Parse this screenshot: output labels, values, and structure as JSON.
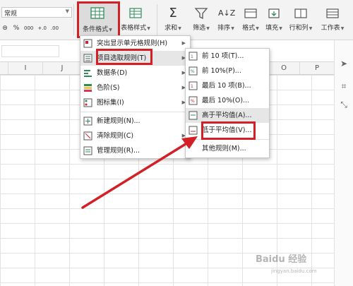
{
  "ribbon": {
    "number_format": "常规",
    "number_buttons": [
      "%",
      "000",
      "+.0",
      ".00"
    ],
    "buttons": {
      "conditional_format": "条件格式",
      "table_style": "表格样式",
      "sum": "求和",
      "filter": "筛选",
      "sort": "排序",
      "format": "格式",
      "fill": "填充",
      "row_col": "行和列",
      "worksheet": "工作表"
    }
  },
  "columns": [
    "I",
    "J",
    "O",
    "P"
  ],
  "menu1": {
    "items": [
      {
        "label": "突出显示单元格规则(H)",
        "icon": "highlight-cells-icon",
        "submenu": true
      },
      {
        "label": "项目选取规则(T)",
        "icon": "top-bottom-rules-icon",
        "submenu": true
      },
      {
        "label": "数据条(D)",
        "icon": "data-bars-icon",
        "submenu": true
      },
      {
        "label": "色阶(S)",
        "icon": "color-scales-icon",
        "submenu": true
      },
      {
        "label": "图标集(I)",
        "icon": "icon-sets-icon",
        "submenu": true
      },
      {
        "label": "新建规则(N)...",
        "icon": "new-rule-icon",
        "submenu": false
      },
      {
        "label": "清除规则(C)",
        "icon": "clear-rules-icon",
        "submenu": true
      },
      {
        "label": "管理规则(R)...",
        "icon": "manage-rules-icon",
        "submenu": false
      }
    ]
  },
  "menu2": {
    "items": [
      {
        "label": "前 10 项(T)...",
        "icon": "top-10-icon"
      },
      {
        "label": "前 10%(P)...",
        "icon": "top-10-percent-icon"
      },
      {
        "label": "最后 10 项(B)...",
        "icon": "bottom-10-icon"
      },
      {
        "label": "最后 10%(O)...",
        "icon": "bottom-10-percent-icon"
      },
      {
        "label": "高于平均值(A)...",
        "icon": "above-average-icon"
      },
      {
        "label": "低于平均值(V)...",
        "icon": "below-average-icon"
      },
      {
        "label": "其他规则(M)...",
        "icon": ""
      }
    ]
  },
  "watermark": {
    "main": "Baidu 经验",
    "sub": "jingyan.baidu.com"
  },
  "colors": {
    "highlight": "#d32027",
    "accent_green": "#2e8b57"
  }
}
